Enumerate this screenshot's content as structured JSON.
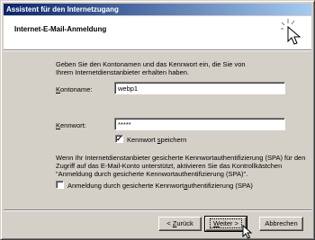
{
  "window": {
    "title": "Assistent für den Internetzugang"
  },
  "header": {
    "title": "Internet-E-Mail-Anmeldung",
    "icon": "wizard-cursor-icon"
  },
  "form": {
    "instruction": "Geben Sie den Kontonamen und das Kennwort ein, die Sie von Ihrem Internetdienstanbieter erhalten haben.",
    "account_label_hotkey": "K",
    "account_label_rest": "ontoname:",
    "account_value": "webp1",
    "password_label_hotkey": "K",
    "password_label_rest": "ennwort:",
    "password_value": "*****",
    "save_password_checked": true,
    "save_password_label_a": "Kennwort ",
    "save_password_label_hotkey": "s",
    "save_password_label_b": "peichern",
    "spa_text": "Wenn Ihr Internetdienstanbieter gesicherte Kennwortauthentifizierung (SPA) für den Zugriff auf das E-Mail-Konto unterstützt, aktivieren Sie das Kontrollkästchen \"Anmeldung durch gesicherte Kennwortauthentifizierung (SPA)\".",
    "spa_checked": false,
    "spa_label_a": "Anmeldung durch gesicherte Kennwort",
    "spa_label_hotkey": "a",
    "spa_label_b": "uthentifizierung (SPA)"
  },
  "buttons": {
    "back_a": "< ",
    "back_hotkey": "Z",
    "back_b": "urück",
    "next_hotkey": "W",
    "next_b": "eiter >",
    "cancel": "Abbrechen"
  }
}
